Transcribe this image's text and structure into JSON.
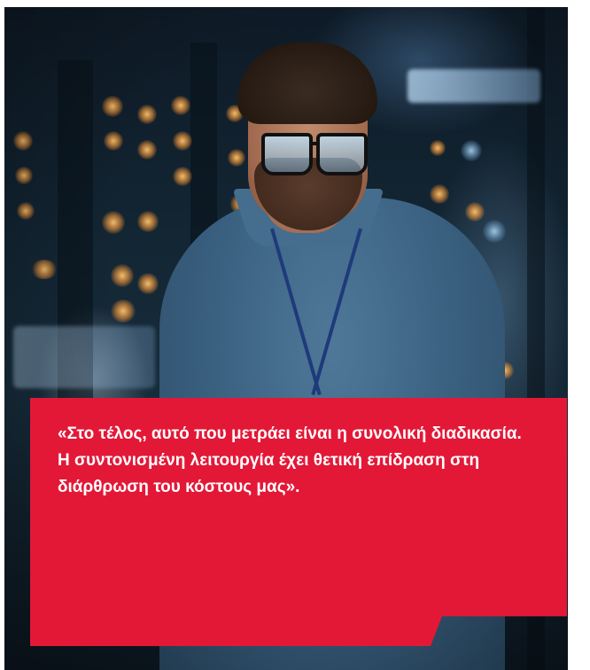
{
  "photo": {
    "description_icon": "man-with-glasses-in-server-room-photo"
  },
  "quote": {
    "text": "«Στο τέλος, αυτό που μετράει είναι η συνολική διαδικασία. Η συντονισμένη λειτουργία έχει θετική επίδραση στη διάρθρωση του κόστους μας»."
  },
  "colors": {
    "accent_red": "#e31837",
    "text": "#ffffff"
  }
}
